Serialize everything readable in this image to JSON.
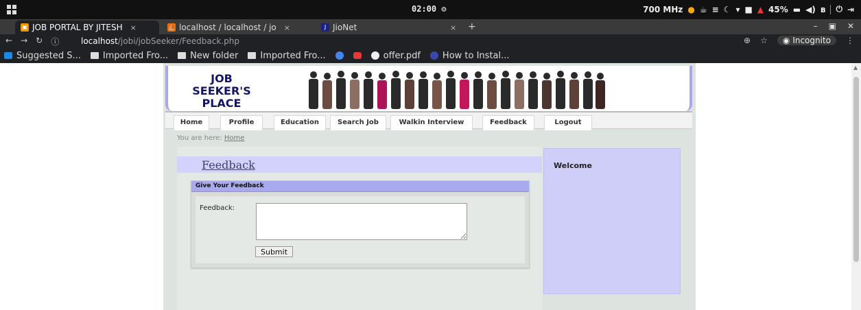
{
  "os": {
    "clock": "02:00",
    "cpu": "700 MHz",
    "battery": "45%"
  },
  "tabs": [
    {
      "label": "JOB PORTAL BY JITESH",
      "close": "×",
      "favicon_color": "#f29900"
    },
    {
      "label": "localhost / localhost / jo",
      "close": "×",
      "favicon_color": "#e8710a"
    },
    {
      "label": "JioNet",
      "close": "×",
      "favicon_color": "#1a237e"
    }
  ],
  "address": {
    "host": "localhost",
    "path": "/jobi/jobSeeker/Feedback.php",
    "incognito_label": "Incognito"
  },
  "bookmarks": [
    {
      "label": "Suggested S...",
      "icon": "suggested-icon"
    },
    {
      "label": "Imported Fro...",
      "icon": "folder-icon"
    },
    {
      "label": "New folder",
      "icon": "folder-icon"
    },
    {
      "label": "Imported Fro...",
      "icon": "folder-icon"
    },
    {
      "label": "",
      "icon": "chrome-icon"
    },
    {
      "label": "",
      "icon": "youtube-icon"
    },
    {
      "label": "offer.pdf",
      "icon": "pdf-icon"
    },
    {
      "label": "How to Instal...",
      "icon": "globe-icon"
    }
  ],
  "site": {
    "logo": {
      "line1": "JOB",
      "line2": "SEEKER'S",
      "line3": "PLACE"
    },
    "menu": [
      "Home",
      "Profile",
      "Education",
      "Search Job",
      "Walkin Interview",
      "Feedback",
      "Logout"
    ],
    "breadcrumb": {
      "prefix": "You are here: ",
      "link": "Home"
    },
    "page_title": "Feedback",
    "form": {
      "header": "Give Your Feedback",
      "label": "Feedback:",
      "value": "",
      "submit": "Submit"
    },
    "sidebar": {
      "title": "Welcome"
    },
    "colors": {
      "accent": "#a9a9ef",
      "sidebar": "#cecef9",
      "title_strip": "#d2d2fb"
    }
  }
}
